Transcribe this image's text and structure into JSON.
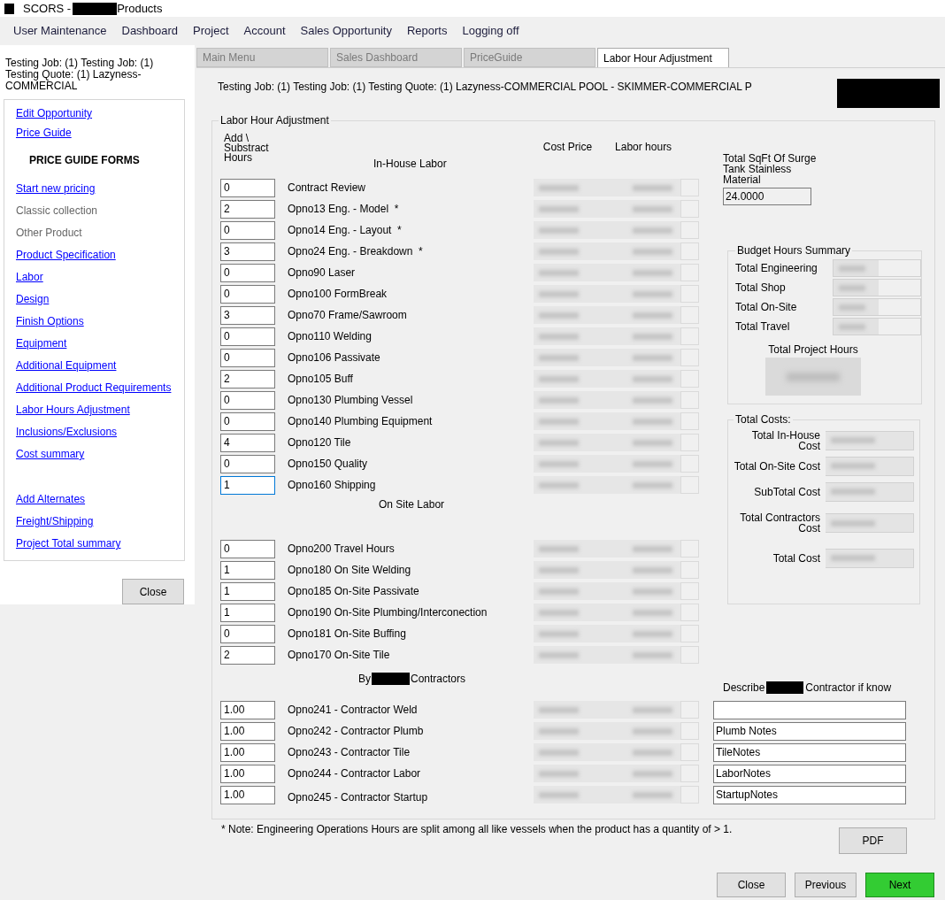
{
  "window": {
    "title_start": "SCORS -",
    "title_end": "Products"
  },
  "menu": [
    "User Maintenance",
    "Dashboard",
    "Project",
    "Account",
    "Sales Opportunity",
    "Reports",
    "Logging off"
  ],
  "sidebar": {
    "job_text": "Testing Job: (1) Testing Job: (1) Testing Quote: (1) Lazyness-COMMERCIAL",
    "link_groups": [
      [
        {
          "label": "Edit Opportunity",
          "kind": "link"
        },
        {
          "label": "Price Guide",
          "kind": "link"
        },
        {
          "label": "PRICE GUIDE FORMS",
          "kind": "heading"
        }
      ],
      [
        {
          "label": "Start new pricing",
          "kind": "link"
        },
        {
          "label": "Classic collection",
          "kind": "plain"
        },
        {
          "label": "Other Product",
          "kind": "plain"
        },
        {
          "label": "Product Specification",
          "kind": "link"
        },
        {
          "label": "Labor",
          "kind": "link"
        },
        {
          "label": "Design",
          "kind": "link"
        },
        {
          "label": "Finish Options",
          "kind": "link"
        },
        {
          "label": "Equipment",
          "kind": "link"
        },
        {
          "label": "Additional Equipment",
          "kind": "link"
        },
        {
          "label": "Additional Product Requirements",
          "kind": "link"
        },
        {
          "label": "Labor Hours Adjustment",
          "kind": "link"
        },
        {
          "label": "Inclusions/Exclusions",
          "kind": "link"
        },
        {
          "label": "Cost summary",
          "kind": "link"
        }
      ],
      [
        {
          "label": "Add Alternates",
          "kind": "link"
        },
        {
          "label": "Freight/Shipping",
          "kind": "link"
        },
        {
          "label": "Project Total summary",
          "kind": "link"
        }
      ]
    ],
    "close_button": "Close"
  },
  "tabs": [
    {
      "label": "Main Menu",
      "selected": false
    },
    {
      "label": "Sales Dashboard",
      "selected": false
    },
    {
      "label": "PriceGuide",
      "selected": false
    },
    {
      "label": "Labor Hour Adjustment",
      "selected": true
    }
  ],
  "header_text": "Testing Job: (1) Testing Job: (1) Testing Quote: (1) Lazyness-COMMERCIAL POOL - SKIMMER-COMMERCIAL P",
  "group": {
    "title": "Labor Hour Adjustment",
    "col_add": "Add \\ Substract Hours",
    "col_cost": "Cost Price",
    "col_hours": "Labor hours",
    "in_house": {
      "heading": "In-House Labor",
      "rows": [
        {
          "hours": "0",
          "label": "Contract Review",
          "focused": false
        },
        {
          "hours": "2",
          "label": "Opno13 Eng. - Model  *",
          "focused": false
        },
        {
          "hours": "0",
          "label": "Opno14 Eng. - Layout  *",
          "focused": false
        },
        {
          "hours": "3",
          "label": "Opno24 Eng. - Breakdown  *",
          "focused": false
        },
        {
          "hours": "0",
          "label": "Opno90 Laser",
          "focused": false
        },
        {
          "hours": "0",
          "label": "Opno100 FormBreak",
          "focused": false
        },
        {
          "hours": "3",
          "label": "Opno70 Frame/Sawroom",
          "focused": false
        },
        {
          "hours": "0",
          "label": "Opno110 Welding",
          "focused": false
        },
        {
          "hours": "0",
          "label": "Opno106 Passivate",
          "focused": false
        },
        {
          "hours": "2",
          "label": "Opno105 Buff",
          "focused": false
        },
        {
          "hours": "0",
          "label": "Opno130 Plumbing Vessel",
          "focused": false
        },
        {
          "hours": "0",
          "label": "Opno140 Plumbing Equipment",
          "focused": false
        },
        {
          "hours": "4",
          "label": "Opno120 Tile",
          "focused": false
        },
        {
          "hours": "0",
          "label": "Opno150 Quality",
          "focused": false
        },
        {
          "hours": "1",
          "label": "Opno160 Shipping",
          "focused": true
        }
      ]
    },
    "on_site": {
      "heading": "On Site Labor",
      "rows": [
        {
          "hours": "0",
          "label": "Opno200 Travel Hours",
          "focused": false
        },
        {
          "hours": "1",
          "label": "Opno180 On Site Welding",
          "focused": false
        },
        {
          "hours": "1",
          "label": "Opno185 On-Site Passivate",
          "focused": false
        },
        {
          "hours": "1",
          "label": "Opno190 On-Site Plumbing/Interconection",
          "focused": false
        },
        {
          "hours": "0",
          "label": "Opno181 On-Site Buffing",
          "focused": false
        },
        {
          "hours": "2",
          "label": "Opno170 On-Site Tile",
          "focused": false
        }
      ]
    },
    "contractors": {
      "heading_start": "By",
      "heading_end": "Contractors",
      "describe_start": "Describe",
      "describe_end": "Contractor if know",
      "rows": [
        {
          "hours": "1.00",
          "label": "Opno241 - Contractor Weld"
        },
        {
          "hours": "1.00",
          "label": "Opno242 - Contractor Plumb",
          "note": "Plumb Notes"
        },
        {
          "hours": "1.00",
          "label": "Opno243 - Contractor Tile",
          "note": "TileNotes"
        },
        {
          "hours": "1.00",
          "label": "Opno244 - Contractor Labor",
          "note": "LaborNotes"
        },
        {
          "hours": "1.00",
          "label": "Opno245 - Contractor Startup",
          "note": "StartupNotes"
        }
      ]
    },
    "sqft": {
      "label": "Total SqFt Of Surge Tank Stainless Material",
      "value": "24.0000"
    },
    "budget": {
      "title": "Budget Hours Summary",
      "items": [
        "Total Engineering",
        "Total Shop",
        "Total On-Site",
        "Total Travel"
      ],
      "total_label": "Total Project Hours"
    },
    "costs": {
      "title": "Total Costs:",
      "items": [
        "Total In-House Cost",
        "Total On-Site Cost",
        "SubTotal Cost",
        "Total Contractors Cost",
        "Total Cost"
      ]
    },
    "note": "* Note: Engineering Operations Hours are split among all like vessels when the product has a quantity of > 1."
  },
  "buttons": [
    {
      "label": "PDF",
      "kind": "plain"
    },
    {
      "label": "Close",
      "kind": "plain"
    },
    {
      "label": "Previous",
      "kind": "plain"
    },
    {
      "label": "Next",
      "kind": "primary"
    }
  ]
}
